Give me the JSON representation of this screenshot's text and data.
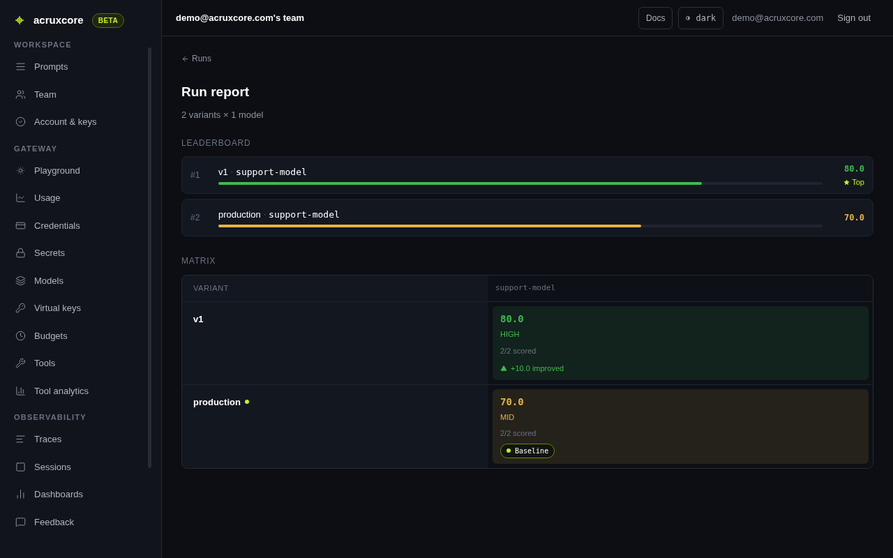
{
  "brand": {
    "name": "acruxcore",
    "badge": "BETA"
  },
  "sidebar": {
    "sections": [
      {
        "title": "WORKSPACE",
        "items": [
          {
            "label": "Prompts"
          },
          {
            "label": "Team"
          },
          {
            "label": "Account & keys"
          }
        ]
      },
      {
        "title": "GATEWAY",
        "items": [
          {
            "label": "Playground"
          },
          {
            "label": "Usage"
          },
          {
            "label": "Credentials"
          },
          {
            "label": "Secrets"
          },
          {
            "label": "Models"
          },
          {
            "label": "Virtual keys"
          },
          {
            "label": "Budgets"
          },
          {
            "label": "Tools"
          },
          {
            "label": "Tool analytics"
          }
        ]
      },
      {
        "title": "OBSERVABILITY",
        "items": [
          {
            "label": "Traces"
          },
          {
            "label": "Sessions"
          },
          {
            "label": "Dashboards"
          },
          {
            "label": "Feedback"
          }
        ]
      }
    ]
  },
  "header": {
    "team": "demo@acruxcore.com's team",
    "docs": "Docs",
    "theme": "dark",
    "email": "demo@acruxcore.com",
    "sign_out": "Sign out"
  },
  "back_link": "Runs",
  "title": "Run report",
  "subtitle": "2 variants × 1 model",
  "leaderboard": {
    "title": "LEADERBOARD",
    "rows": [
      {
        "rank": "#1",
        "variant": "v1",
        "separator": "·",
        "model": "support-model",
        "score": "80.0",
        "level": 0.8,
        "color": "#3fb950",
        "top": true,
        "top_label": "Top"
      },
      {
        "rank": "#2",
        "variant": "production",
        "separator": "·",
        "model": "support-model",
        "score": "70.0",
        "level": 0.7,
        "color": "#e3b341",
        "top": false
      }
    ]
  },
  "matrix": {
    "title": "MATRIX",
    "columns": [
      "VARIANT",
      "support-model"
    ],
    "rows": [
      {
        "variant": "v1",
        "baseline": false,
        "cell": {
          "score": "80.0",
          "tier": "HIGH",
          "scored": "2/2 scored",
          "color": "#3fb950",
          "note": {
            "kind": "delta",
            "text": "+10.0 improved"
          }
        }
      },
      {
        "variant": "production",
        "baseline": true,
        "cell": {
          "score": "70.0",
          "tier": "MID",
          "scored": "2/2 scored",
          "color": "#e3b341",
          "note": {
            "kind": "baseline",
            "text": "Baseline"
          }
        }
      }
    ]
  }
}
